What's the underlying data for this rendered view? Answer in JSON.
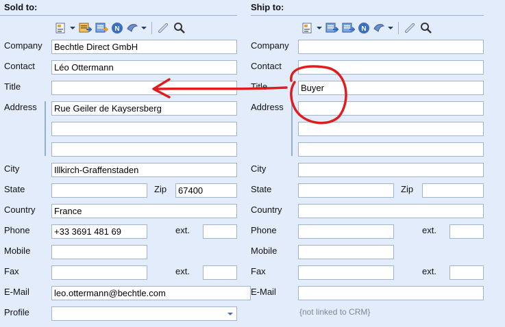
{
  "sold_to": {
    "heading": "Sold to:",
    "labels": {
      "company": "Company",
      "contact": "Contact",
      "title": "Title",
      "address": "Address",
      "city": "City",
      "state": "State",
      "zip": "Zip",
      "country": "Country",
      "phone": "Phone",
      "ext": "ext.",
      "mobile": "Mobile",
      "fax": "Fax",
      "email": "E-Mail",
      "profile": "Profile"
    },
    "values": {
      "company": "Bechtle Direct GmbH",
      "contact": "Léo Ottermann",
      "title": "",
      "address1": "Rue Geiler de Kaysersberg",
      "address2": "",
      "address3": "",
      "city": "Illkirch-Graffenstaden",
      "state": "",
      "zip": "67400",
      "country": "France",
      "phone": "+33 3691 481 69",
      "phone_ext": "",
      "mobile": "",
      "fax": "",
      "fax_ext": "",
      "email": "leo.ottermann@bechtle.com",
      "profile": ""
    }
  },
  "ship_to": {
    "heading": "Ship to:",
    "labels": {
      "company": "Company",
      "contact": "Contact",
      "title": "Title",
      "address": "Address",
      "city": "City",
      "state": "State",
      "zip": "Zip",
      "country": "Country",
      "phone": "Phone",
      "ext": "ext.",
      "mobile": "Mobile",
      "fax": "Fax",
      "email": "E-Mail"
    },
    "values": {
      "company": "",
      "contact": "",
      "title": "Buyer",
      "address1": "",
      "address2": "",
      "address3": "",
      "city": "",
      "state": "",
      "zip": "",
      "country": "",
      "phone": "",
      "phone_ext": "",
      "mobile": "",
      "fax": "",
      "fax_ext": "",
      "email": ""
    },
    "crm_note": "{not linked to CRM}"
  },
  "toolbar_icons": [
    "address-card-icon",
    "dropdown-arrow-icon",
    "copy-address-icon",
    "transfer-address-icon",
    "n-badge-icon",
    "map-pin-icon",
    "dropdown-arrow-icon",
    "link-icon",
    "search-icon"
  ],
  "annotation_color": "#e01d1d"
}
